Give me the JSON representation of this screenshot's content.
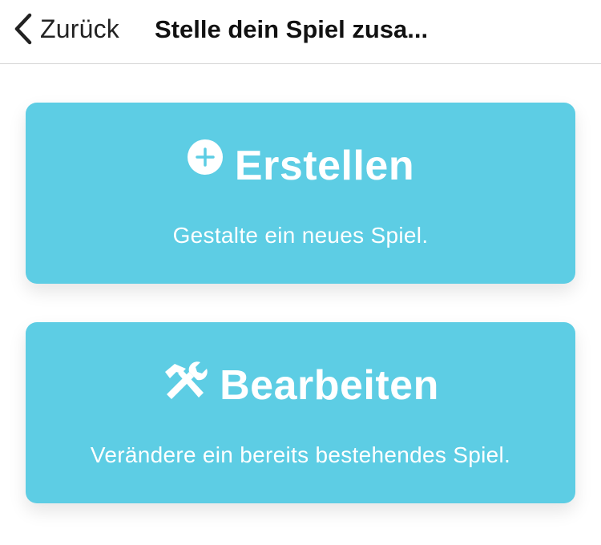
{
  "navbar": {
    "back_label": "Zurück",
    "back_icon": "chevron-left-icon",
    "title": "Stelle dein Spiel zusa..."
  },
  "actions": [
    {
      "title": "Erstellen",
      "subtitle": "Gestalte ein neues Spiel.",
      "icon": "plus-circle-icon"
    },
    {
      "title": "Bearbeiten",
      "subtitle": "Verändere ein bereits bestehendes Spiel.",
      "icon": "tools-icon"
    }
  ],
  "colors": {
    "card_background": "#5dcde4",
    "card_text": "#ffffff",
    "nav_text": "#111111"
  }
}
